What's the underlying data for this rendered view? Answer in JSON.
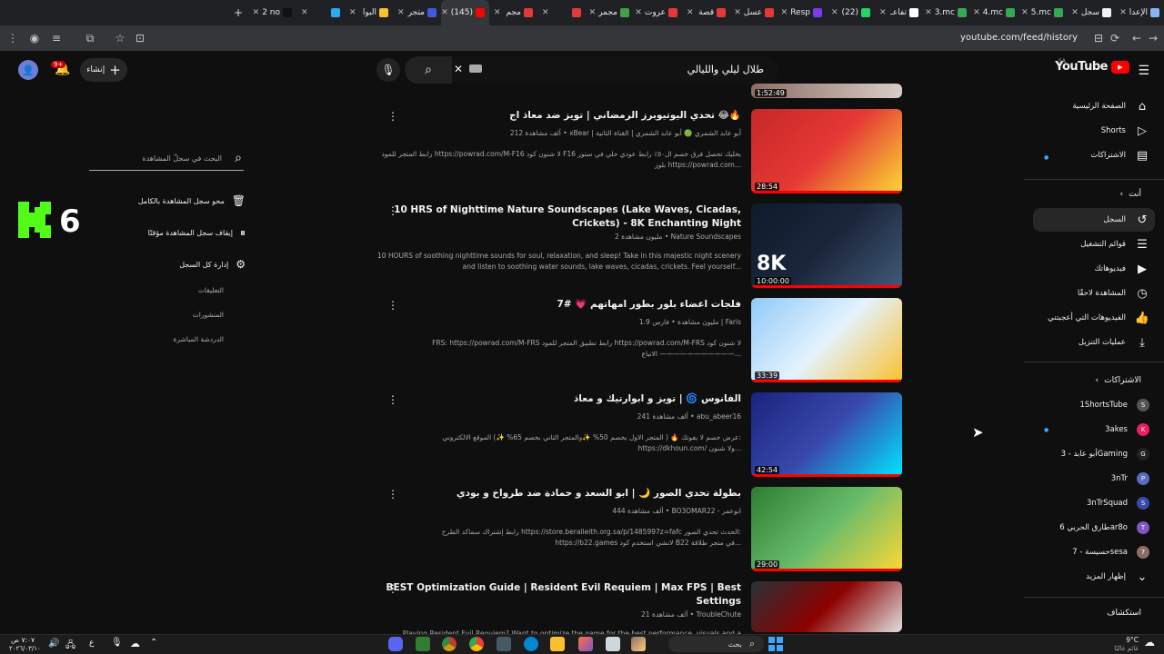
{
  "browser": {
    "url": "youtube.com/feed/history",
    "tabs": [
      {
        "label": "الإعدا",
        "color": "#8ab4f8"
      },
      {
        "label": "سجل",
        "color": "#f1f1f1"
      },
      {
        "label": "5.mc",
        "color": "#34a853"
      },
      {
        "label": "4.mc",
        "color": "#34a853"
      },
      {
        "label": "3.mc",
        "color": "#34a853"
      },
      {
        "label": "تفاعـ",
        "color": "#ffffff"
      },
      {
        "label": "(22)",
        "color": "#25d366"
      },
      {
        "label": "Resp",
        "color": "#7c3aed"
      },
      {
        "label": "عسل",
        "color": "#e53935"
      },
      {
        "label": "قصة",
        "color": "#e53935"
      },
      {
        "label": "عروت",
        "color": "#e53935"
      },
      {
        "label": "مجمر",
        "color": "#43a047"
      },
      {
        "label": "",
        "color": "#e53935"
      },
      {
        "label": "مجم",
        "color": "#e53935"
      },
      {
        "label": "(145)",
        "color": "#ff0000",
        "active": true
      },
      {
        "label": "متجر",
        "color": "#3b5bdb"
      },
      {
        "label": "البوا",
        "color": "#fbc02d"
      },
      {
        "label": "",
        "color": "#2aabee"
      },
      {
        "label": "2 no",
        "color": "#111111"
      }
    ],
    "icons": [
      "back-icon",
      "forward-icon",
      "reload-icon",
      "menu-icon",
      "extensions-icon",
      "bookmark-icon"
    ]
  },
  "youtube": {
    "logo_text": "YouTube",
    "logo_region": "SA",
    "search_query": "طلال ليلي والليالي",
    "create_label": "إنشاء",
    "notification_count": "9+"
  },
  "sidebar": {
    "main": [
      {
        "label": "الصفحة الرئيسية",
        "icon": "home-icon"
      },
      {
        "label": "Shorts",
        "icon": "shorts-icon"
      },
      {
        "label": "الاشتراكات",
        "icon": "subscriptions-icon"
      }
    ],
    "you_heading": "أنت",
    "you": [
      {
        "label": "السجل",
        "icon": "history-icon",
        "active": true
      },
      {
        "label": "قوائم التشغيل",
        "icon": "playlists-icon"
      },
      {
        "label": "فيديوهاتك",
        "icon": "your-videos-icon"
      },
      {
        "label": "المشاهدة لاحقًا",
        "icon": "watch-later-icon"
      },
      {
        "label": "الفيديوهات التي أعجبتني",
        "icon": "liked-icon"
      },
      {
        "label": "عمليات التنزيل",
        "icon": "download-icon"
      }
    ],
    "subs_heading": "الاشتراكات",
    "subscriptions": [
      {
        "label": "1ShortsTube",
        "avatar": "#555555",
        "text": "ST"
      },
      {
        "label": "3akes",
        "avatar": "#e91e63",
        "text": "K"
      },
      {
        "label": "أبو عابد - 3Gaming",
        "avatar": "#222222",
        "text": "G"
      },
      {
        "label": "3nTr",
        "avatar": "#5c6bc0",
        "text": "PMR"
      },
      {
        "label": "3nTrSquad",
        "avatar": "#3949ab",
        "text": "S"
      },
      {
        "label": "طارق الحربي 6ar8o",
        "avatar": "#7e57c2",
        "text": "T"
      },
      {
        "label": "حسيسة - 7sesa",
        "avatar": "#8d6e63",
        "text": "7"
      }
    ],
    "show_more": "إظهار المزيد",
    "explore": "استكشاف"
  },
  "videos": [
    {
      "title": "تحدي اليوتيوبرز الرمضاني | تويز ضد معاذ اج 😂🔥",
      "channel": "xBear | أبو عابد الشمري 🟢 أبو عابد الشمري | القناة الثانية",
      "views": "212 ألف مشاهدة",
      "desc": "رابط المتجر للمود https://powrad.com/M-F16 لا شنون كود F16 بخليك تحصل فرق خصم ال٥٠٪ رابط عودي حلي في ستور بلوز https://powrad.com...",
      "duration": "28:54",
      "thumb_colors": [
        "#c62828",
        "#e53935",
        "#fdd835"
      ]
    },
    {
      "title": "10 HRS of Nighttime Nature Soundscapes (Lake Waves, Cicadas, Crickets) - 8K Enchanting Night",
      "channel": "Nature Soundscapes",
      "views": "2 مليون مشاهدة",
      "desc": "10 HOURS of soothing nighttime sounds for soul, relaxation, and sleep! Take in this majestic night scenery and listen to soothing water sounds, lake waves, cicadas, crickets. Feel yourself...",
      "duration": "10:00:00",
      "thumb_colors": [
        "#0d1b2a",
        "#1b263b",
        "#415a77"
      ],
      "badge": "8K"
    },
    {
      "title": "فلجات اعضاء بلور بطور امهاتهم 💗 #7",
      "channel": "فارس | Faris",
      "views": "1.9 مليون مشاهدة",
      "desc": "FRS: https://powrad.com/M-FRS رابط تطبيق المتجر للمود https://powrad.com/M-FRS لا شنون كود ——————————— الاتباع...",
      "duration": "33:39",
      "thumb_colors": [
        "#90caf9",
        "#e3f2fd",
        "#fbc02d"
      ]
    },
    {
      "title": "الفانوس 🌀 | تويز و ابوارتيك و معاذ",
      "channel": "abu_abeer16",
      "views": "241 ألف مشاهدة",
      "desc": "عرض خصم لا يفوتك 🔥 ( المتجر الاول بخصم 50% ✨والمتجر الثاني بخصم 65% ✨) الموقع الالكتروني: https://dkhoun.com/ ولا شنون...",
      "duration": "42:54",
      "thumb_colors": [
        "#1a237e",
        "#3949ab",
        "#00e5ff"
      ]
    },
    {
      "title": "بطولة تحدي الصور 🌙 | ابو السعد و حمادة ضد طرواخ و بودي",
      "channel": "BO3OMAR22 - ابوعمر",
      "views": "444 ألف مشاهدة",
      "desc": "رابط إشتراك سماكد الطرح https://store.beralleith.org.sa/p/1485997z=fafc الحدث تحدي الصور: https://b22.games لانشي استخدم كود B22 في متجر طلاقة...",
      "duration": "29:00",
      "thumb_colors": [
        "#2e7d32",
        "#66bb6a",
        "#fdd835"
      ]
    },
    {
      "title": "BEST Optimization Guide | Resident Evil Requiem | Max FPS | Best Settings",
      "channel": "TroubleChute",
      "views": "21 ألف مشاهدة",
      "desc": "Playing Resident Evil Requiem? Want to optimize the game for the best performance, visuals and a massive",
      "duration": "",
      "thumb_colors": [
        "#263238",
        "#8d0000",
        "#e0e0e0"
      ]
    }
  ],
  "top_thumb_duration": "1:52:49",
  "left_panel": {
    "search_placeholder": "البحث في سجلّ المشاهدة",
    "actions": [
      {
        "label": "محو سجل المشاهدة بالكامل",
        "icon": "trash-icon"
      },
      {
        "label": "إيقاف سجل المشاهدة مؤقتًا",
        "icon": "pause-icon"
      },
      {
        "label": "إدارة كل السجل",
        "icon": "settings-icon"
      }
    ],
    "links": [
      "التعليقات",
      "المنشورات",
      "الدردشة المباشرة"
    ],
    "overlay_text": "6"
  },
  "taskbar": {
    "search_label": "بحث",
    "time": "٧:٠٧ ص",
    "date": "٢٠٢٦/٠٣/١٠",
    "weather_temp": "9°C",
    "weather_desc": "غائم غالبًا",
    "lang": "ع"
  }
}
